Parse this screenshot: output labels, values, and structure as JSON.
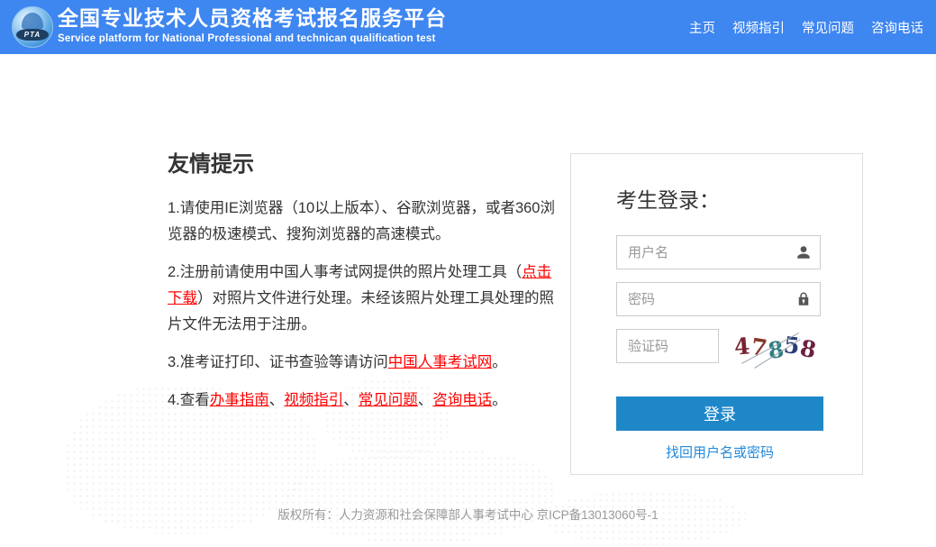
{
  "header": {
    "logo_text": "PTA",
    "title": "全国专业技术人员资格考试报名服务平台",
    "subtitle": "Service platform for National Professional and technican qualification test",
    "nav": [
      "主页",
      "视频指引",
      "常见问题",
      "咨询电话"
    ]
  },
  "tips": {
    "title": "友情提示",
    "item1": "1.请使用IE浏览器（10以上版本）、谷歌浏览器，或者360浏览器的极速模式、搜狗浏览器的高速模式。",
    "item2": {
      "pre": "2.注册前请使用中国人事考试网提供的照片处理工具（",
      "link": "点击下载",
      "post": "）对照片文件进行处理。未经该照片处理工具处理的照片文件无法用于注册。"
    },
    "item3": {
      "pre": "3.准考证打印、证书查验等请访问",
      "link": "中国人事考试网",
      "post": "。"
    },
    "item4": {
      "pre": "4.查看",
      "links": [
        "办事指南",
        "视频指引",
        "常见问题",
        "咨询电话"
      ],
      "sep": "、",
      "post": "。"
    }
  },
  "login": {
    "title": "考生登录：",
    "username_placeholder": "用户名",
    "password_placeholder": "密码",
    "captcha_placeholder": "验证码",
    "captcha_code": "47858",
    "captcha_digits": [
      {
        "ch": "4",
        "color": "#7B2230"
      },
      {
        "ch": "7",
        "color": "#83362A"
      },
      {
        "ch": "8",
        "color": "#2F7F82"
      },
      {
        "ch": "5",
        "color": "#283C77"
      },
      {
        "ch": "8",
        "color": "#6B2040"
      }
    ],
    "login_button": "登录",
    "forgot_link": "找回用户名或密码"
  },
  "footer": {
    "copyright": "版权所有：人力资源和社会保障部人事考试中心 京ICP备13013060号-1"
  },
  "colors": {
    "header_blue": "#3E86F0",
    "button_blue": "#1E87C8",
    "link_red": "#ff0000",
    "link_blue": "#2189DB"
  }
}
